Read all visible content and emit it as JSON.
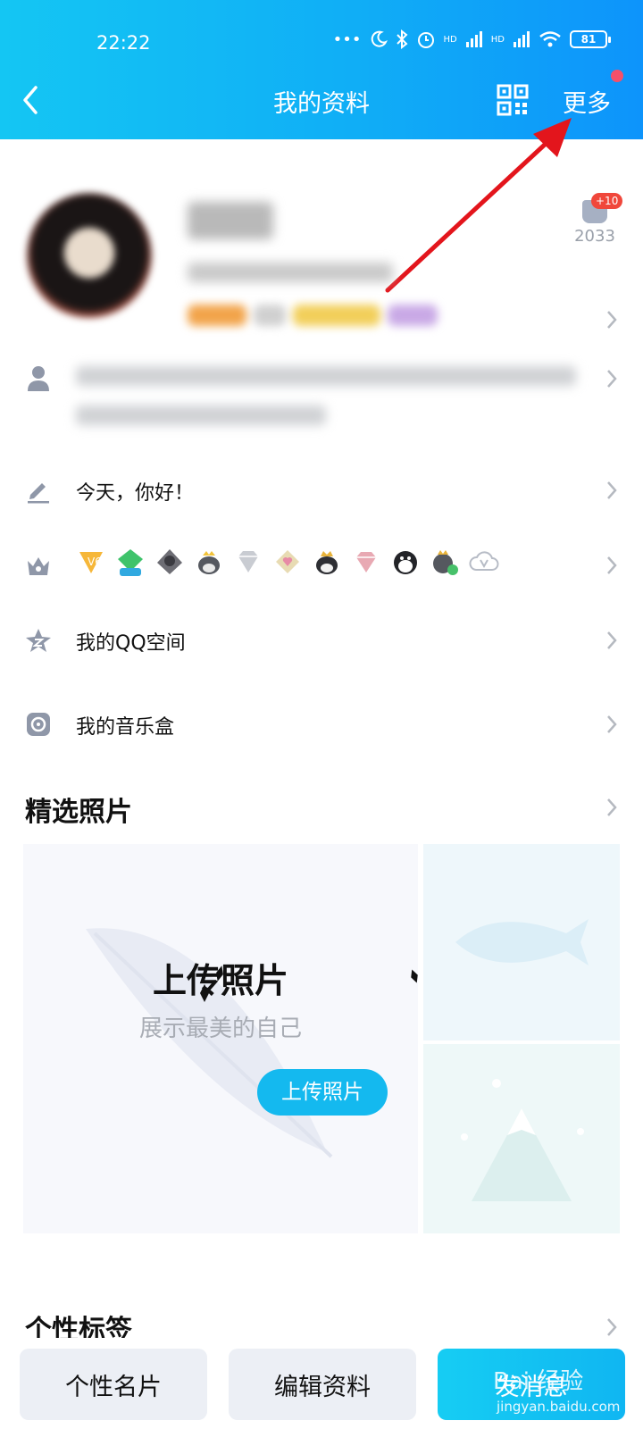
{
  "status_bar": {
    "time": "22:22",
    "dots": "•••",
    "hd1": "HD",
    "hd2": "HD",
    "battery": "81"
  },
  "header": {
    "title": "我的资料",
    "more_label": "更多"
  },
  "profile": {
    "like_badge": "+10",
    "like_count": "2033"
  },
  "rows": {
    "signature": "今天，你好！",
    "qzone": "我的QQ空间",
    "music": "我的音乐盒"
  },
  "badges": [
    "V6",
    "LV4",
    "penguin-knight",
    "penguin-crown",
    "diamond-gray",
    "diamond-heart",
    "penguin-king",
    "diamond-pink",
    "penguin-dark",
    "penguin-green",
    "cloud-v"
  ],
  "photos": {
    "section_title": "精选照片",
    "upload_title": "上传照片",
    "upload_sub": "展示最美的自己",
    "upload_button": "上传照片"
  },
  "tags": {
    "section_title": "个性标签"
  },
  "bottom_bar": {
    "card": "个性名片",
    "edit": "编辑资料",
    "send": "发消息"
  },
  "watermark": {
    "main": "Bai 经验",
    "sub": "jingyan.baidu.com"
  },
  "colors": {
    "header_start": "#14c6f3",
    "header_end": "#0d94fb",
    "accent": "#14b9ef",
    "arrow": "#e3151c",
    "badge_red": "#f0473b"
  }
}
